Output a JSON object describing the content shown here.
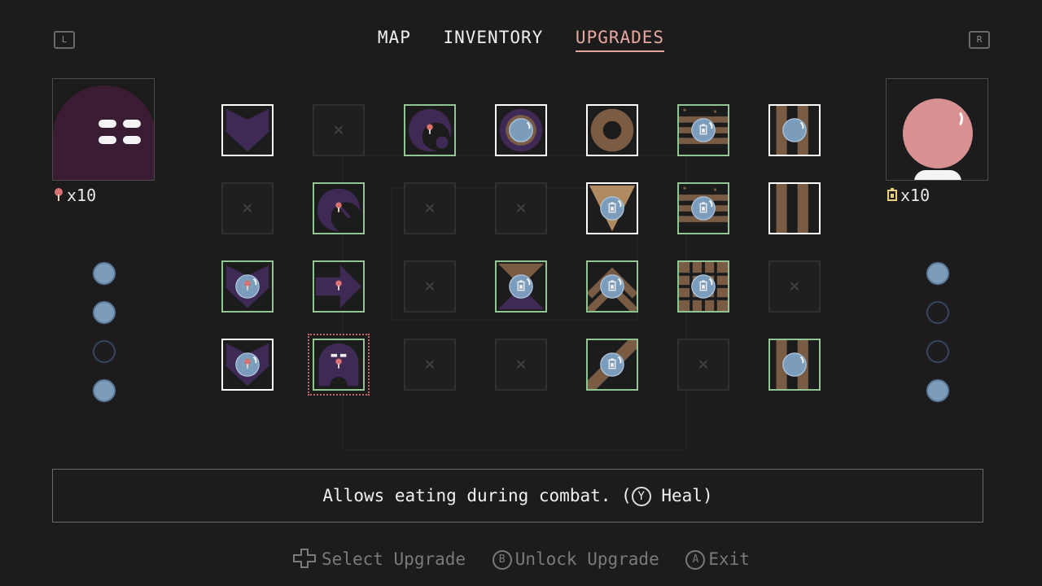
{
  "shoulders": {
    "left": "L",
    "right": "R"
  },
  "tabs": [
    {
      "label": "MAP",
      "active": false
    },
    {
      "label": "INVENTORY",
      "active": false
    },
    {
      "label": "UPGRADES",
      "active": true
    }
  ],
  "left_resource": {
    "count": "x10",
    "icon": "mushroom-icon"
  },
  "right_resource": {
    "count": "x10",
    "icon": "battery-icon"
  },
  "left_pips": [
    true,
    true,
    false,
    true
  ],
  "right_pips": [
    true,
    false,
    false,
    true
  ],
  "grid": [
    [
      "owned-heart",
      "locked",
      "avail-moon-mushroom",
      "owned-ring-orb",
      "owned-donut",
      "avail-battery-stripes",
      "owned-bars-orb"
    ],
    [
      "locked",
      "avail-moon-mushroom-2",
      "locked",
      "locked",
      "owned-triangle-orb",
      "avail-battery-stripes-2",
      "owned-bars"
    ],
    [
      "avail-heart-orb",
      "avail-arrow-mushroom",
      "locked",
      "avail-hourglass-orb",
      "avail-chevron-orb",
      "avail-grid-orb",
      "locked"
    ],
    [
      "owned-heart-orb",
      "selected-ghost",
      "locked",
      "locked",
      "avail-diagonal-orb",
      "locked",
      "avail-bars-orb"
    ]
  ],
  "description": {
    "text": "Allows eating during combat.",
    "button": "Y",
    "action": "Heal"
  },
  "hints": [
    {
      "icon": "dpad-icon",
      "label": "Select Upgrade"
    },
    {
      "icon": "b-button-icon",
      "button": "B",
      "label": "Unlock Upgrade"
    },
    {
      "icon": "a-button-icon",
      "button": "A",
      "label": "Exit"
    }
  ],
  "colors": {
    "accent": "#e8a6a0",
    "owned": "#ffffff",
    "available": "#8fc493",
    "locked": "#2f2f2f",
    "purple": "#3b1d33",
    "brown": "#7a5c45",
    "orb": "#7b9cba"
  }
}
